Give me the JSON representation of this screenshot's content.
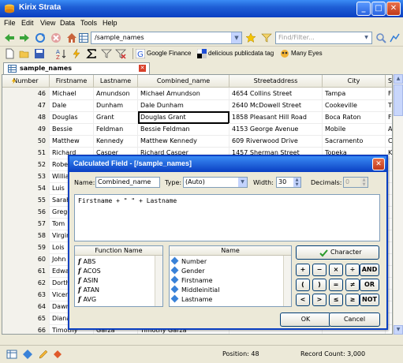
{
  "window": {
    "title": "Kirix Strata",
    "min": "_",
    "max": "□",
    "close": "✕"
  },
  "menu": [
    "File",
    "Edit",
    "View",
    "Data",
    "Tools",
    "Help"
  ],
  "nav": {
    "url": "/sample_names",
    "filter_placeholder": "Find/Filter..."
  },
  "bookmarks": [
    "Google Finance",
    "delicious publicdata tag",
    "Many Eyes"
  ],
  "tab": {
    "label": "sample_names"
  },
  "grid": {
    "headers": [
      "Number",
      "Firstname",
      "Lastname",
      "Combined_name",
      "Streetaddress",
      "City",
      "S"
    ],
    "rows": [
      [
        "46",
        "Michael",
        "Amundson",
        "Michael Amundson",
        "4654 Collins Street",
        "Tampa",
        "FL"
      ],
      [
        "47",
        "Dale",
        "Dunham",
        "Dale Dunham",
        "2640 McDowell Street",
        "Cookeville",
        "TN"
      ],
      [
        "48",
        "Douglas",
        "Grant",
        "Douglas Grant",
        "1858 Pleasant Hill Road",
        "Boca Raton",
        "FL"
      ],
      [
        "49",
        "Bessie",
        "Feldman",
        "Bessie Feldman",
        "4153 George Avenue",
        "Mobile",
        "AL"
      ],
      [
        "50",
        "Matthew",
        "Kennedy",
        "Matthew Kennedy",
        "609 Riverwood Drive",
        "Sacramento",
        "CA"
      ],
      [
        "51",
        "Richard",
        "Casper",
        "Richard Casper",
        "1457 Sherman Street",
        "Topeka",
        "KS"
      ],
      [
        "52",
        "Robert",
        "",
        "",
        "",
        "",
        ""
      ],
      [
        "53",
        "William",
        "",
        "",
        "",
        "",
        ""
      ],
      [
        "54",
        "Luis",
        "",
        "",
        "",
        "",
        ""
      ],
      [
        "55",
        "Sarah",
        "",
        "",
        "",
        "",
        ""
      ],
      [
        "56",
        "Gregory",
        "",
        "",
        "",
        "",
        ""
      ],
      [
        "57",
        "Tom",
        "",
        "",
        "",
        "",
        ""
      ],
      [
        "58",
        "Virginia",
        "",
        "",
        "",
        "",
        ""
      ],
      [
        "59",
        "Lois",
        "",
        "",
        "",
        "",
        ""
      ],
      [
        "60",
        "John",
        "",
        "",
        "",
        "",
        ""
      ],
      [
        "61",
        "Edward",
        "",
        "",
        "",
        "",
        ""
      ],
      [
        "62",
        "Dorthy",
        "",
        "",
        "",
        "",
        ""
      ],
      [
        "63",
        "Vicente",
        "",
        "",
        "",
        "",
        ""
      ],
      [
        "64",
        "Dawn",
        "",
        "",
        "",
        "",
        ""
      ],
      [
        "65",
        "Diana",
        "",
        "",
        "",
        "",
        ""
      ],
      [
        "66",
        "Timothy",
        "Garza",
        "Timothy Garza",
        "",
        "",
        ""
      ]
    ]
  },
  "status": {
    "position": "Position: 48",
    "record_count": "Record Count: 3,000"
  },
  "dialog": {
    "title": "Calculated Field - [/sample_names]",
    "name_label": "Name:",
    "name_value": "Combined_name",
    "type_label": "Type:",
    "type_value": "(Auto)",
    "width_label": "Width:",
    "width_value": "30",
    "decimals_label": "Decimals:",
    "decimals_value": "0",
    "expression": "Firstname + \" \" + Lastname",
    "functions_header": "Function Name",
    "functions": [
      "ABS",
      "ACOS",
      "ASIN",
      "ATAN",
      "AVG"
    ],
    "fields_header": "Name",
    "fields": [
      "Number",
      "Gender",
      "Firstname",
      "Middleinitial",
      "Lastname"
    ],
    "character_button": "Character",
    "operators": [
      "+",
      "−",
      "×",
      "÷",
      "AND",
      "(",
      ")",
      "=",
      "≠",
      "OR",
      "<",
      ">",
      "≤",
      "≥",
      "NOT"
    ],
    "ok": "OK",
    "cancel": "Cancel"
  }
}
